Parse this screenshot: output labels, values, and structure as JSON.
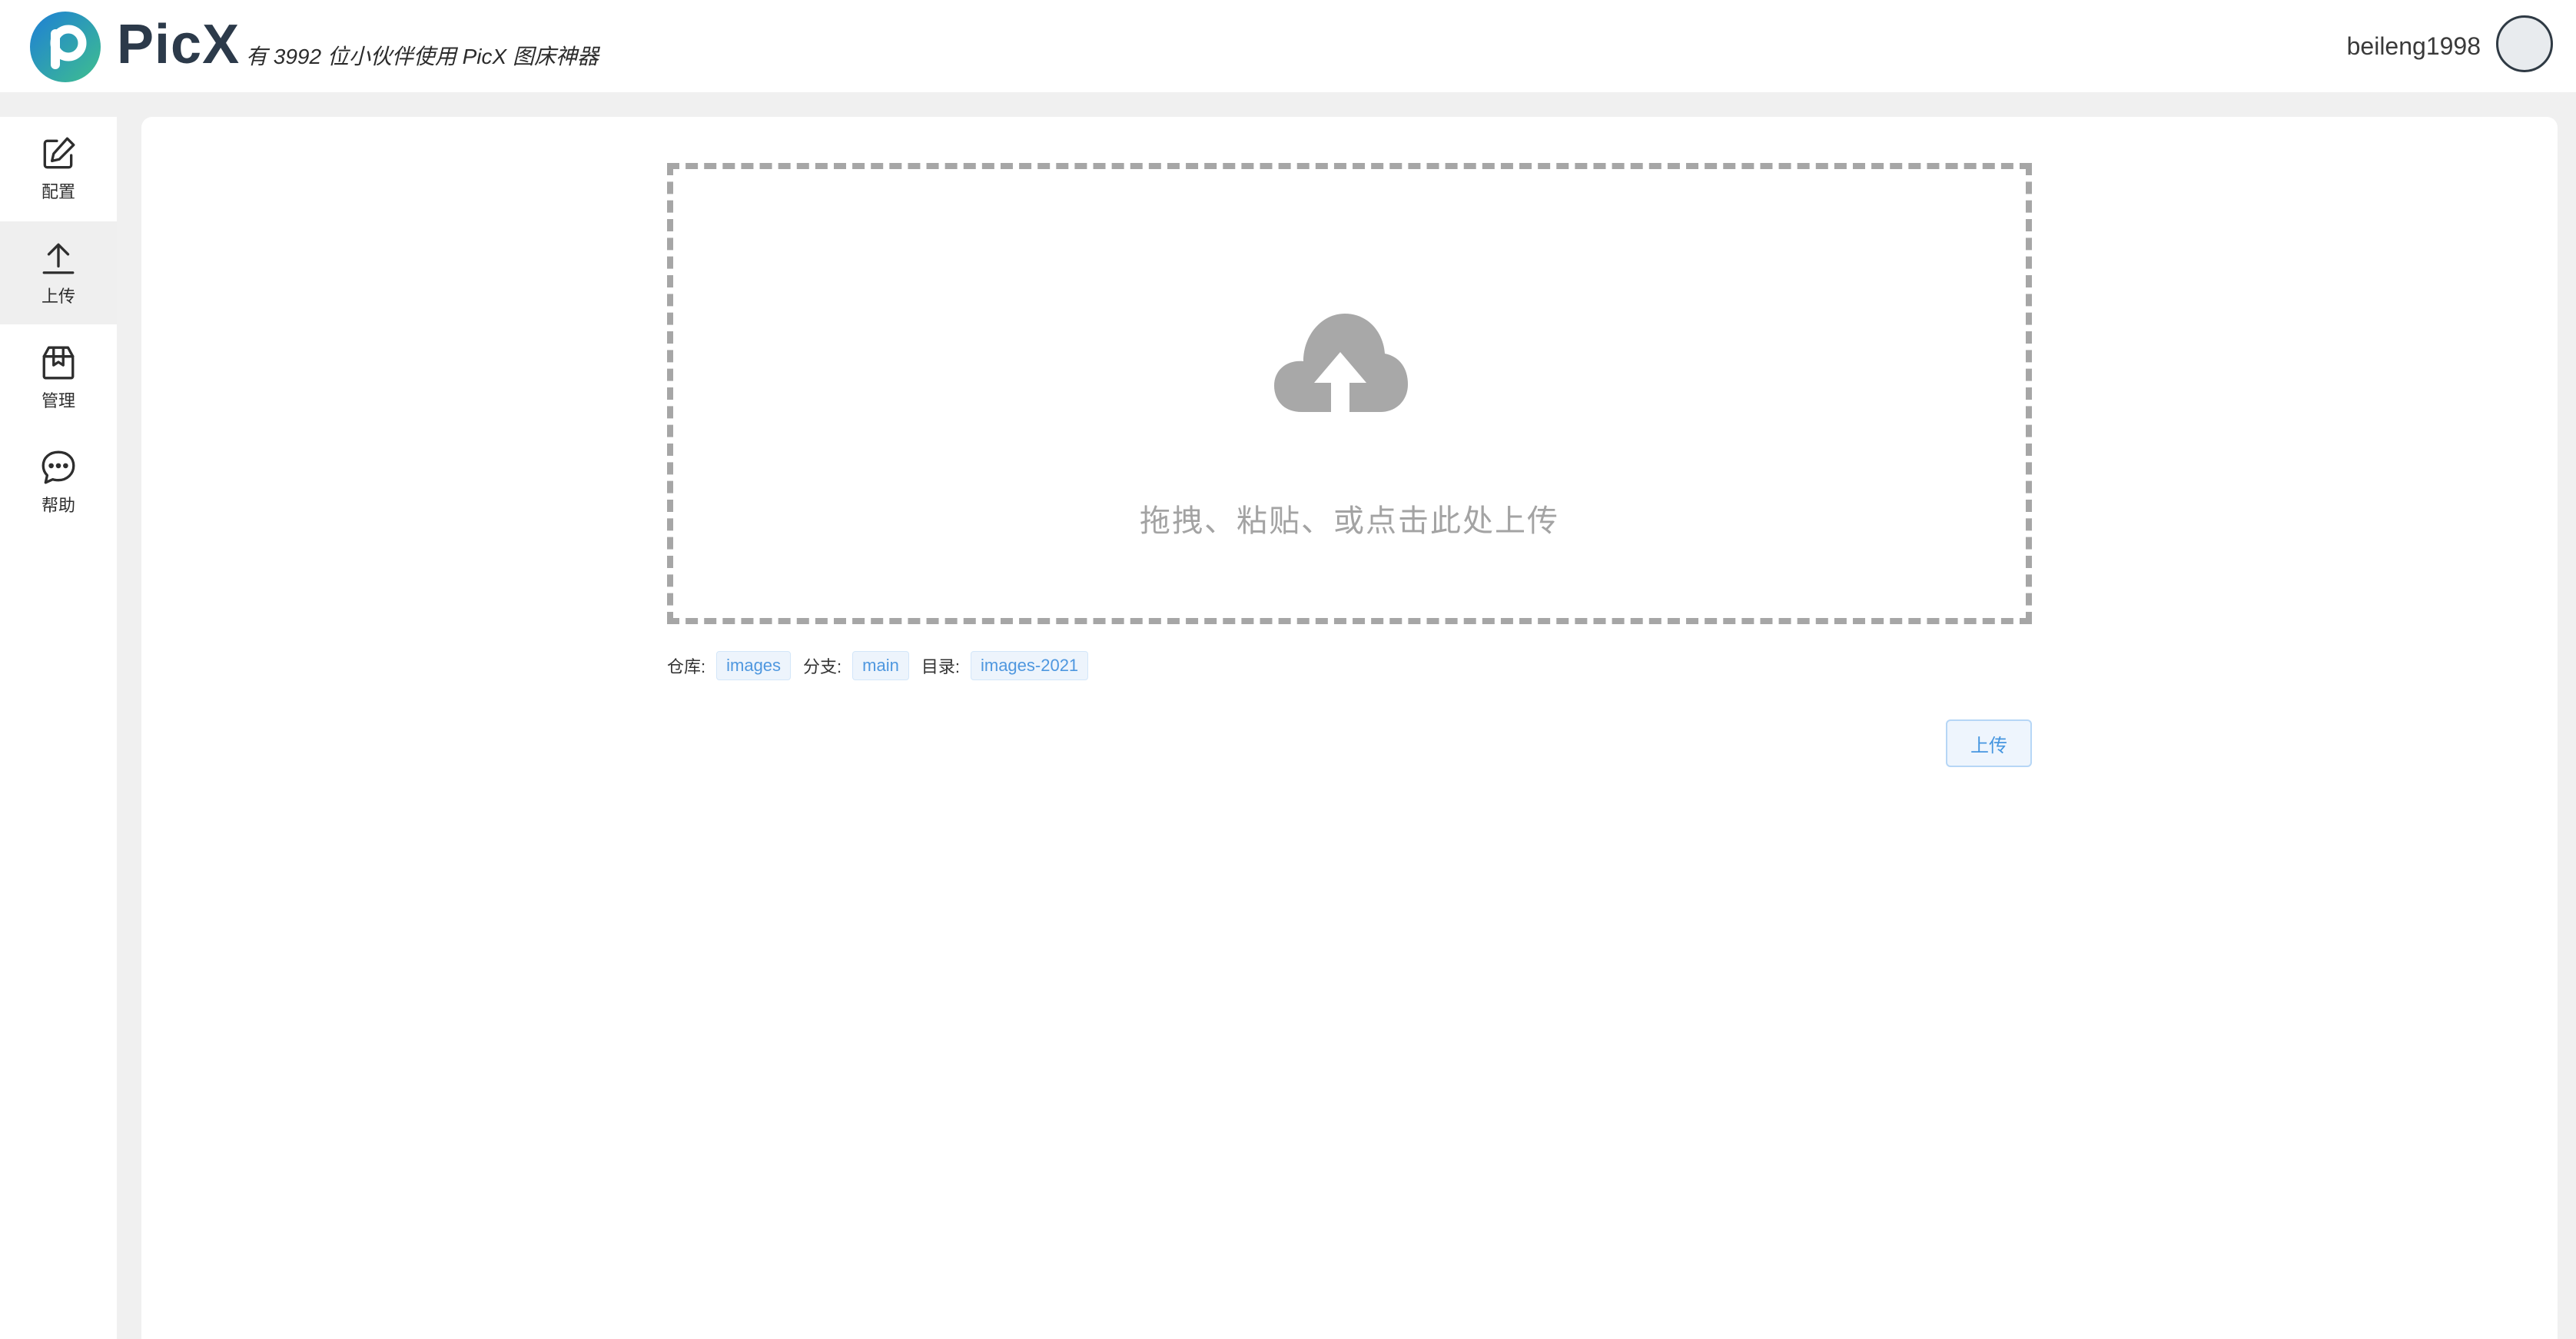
{
  "header": {
    "brand": "PicX",
    "tagline": "有 3992 位小伙伴使用 PicX 图床神器",
    "username": "beileng1998"
  },
  "sidebar": {
    "items": [
      {
        "label": "配置",
        "icon": "edit-icon"
      },
      {
        "label": "上传",
        "icon": "upload-icon",
        "active": true
      },
      {
        "label": "管理",
        "icon": "box-icon"
      },
      {
        "label": "帮助",
        "icon": "chat-icon"
      }
    ]
  },
  "main": {
    "dropzone": {
      "text": "拖拽、粘贴、或点击此处上传",
      "icon": "cloud-upload-icon"
    },
    "info": {
      "repo_label": "仓库:",
      "repo_value": "images",
      "branch_label": "分支:",
      "branch_value": "main",
      "dir_label": "目录:",
      "dir_value": "images-2021"
    },
    "upload_button": "上传"
  },
  "colors": {
    "accent": "#4e97df",
    "brand_dark": "#2c3a4a",
    "logo_gradient_start": "#1e7fd6",
    "logo_gradient_end": "#3fbf8e",
    "dashed_border": "#a6a6a6"
  }
}
